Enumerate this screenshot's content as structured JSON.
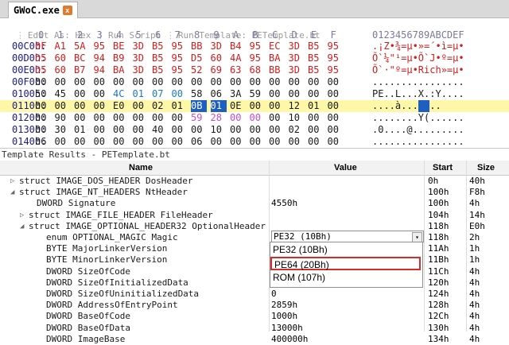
{
  "tab": {
    "title": "GWoC.exe",
    "close_glyph": "x",
    "accent": "#e07a2a"
  },
  "info_bar": {
    "edit_as": "Edit As: Hex",
    "run_script": "Run Script",
    "run_template": "Run Template: PETemplate.bt"
  },
  "hex": {
    "col_headers": [
      "0",
      "1",
      "2",
      "3",
      "4",
      "5",
      "6",
      "7",
      "8",
      "9",
      "A",
      "B",
      "C",
      "D",
      "E",
      "F"
    ],
    "ascii_header": "0123456789ABCDEF",
    "rows": [
      {
        "addr": "00C0h:",
        "bytes": [
          "0F",
          "A1",
          "5A",
          "95",
          "BE",
          "3D",
          "B5",
          "95",
          "BB",
          "3D",
          "B4",
          "95",
          "EC",
          "3D",
          "B5",
          "95"
        ],
        "ascii": ".¡Z•¾=µ•»=´•ì=µ•"
      },
      {
        "addr": "00D0h:",
        "bytes": [
          "D5",
          "60",
          "BC",
          "94",
          "B9",
          "3D",
          "B5",
          "95",
          "D5",
          "60",
          "4A",
          "95",
          "BA",
          "3D",
          "B5",
          "95"
        ],
        "ascii": "Õ`¼\"¹=µ•Õ`J•º=µ•"
      },
      {
        "addr": "00E0h:",
        "bytes": [
          "D5",
          "60",
          "B7",
          "94",
          "BA",
          "3D",
          "B5",
          "95",
          "52",
          "69",
          "63",
          "68",
          "BB",
          "3D",
          "B5",
          "95"
        ],
        "ascii": "Õ`·\"º=µ•Rich»=µ•"
      },
      {
        "addr": "00F0h:",
        "bytes": [
          "00",
          "00",
          "00",
          "00",
          "00",
          "00",
          "00",
          "00",
          "00",
          "00",
          "00",
          "00",
          "00",
          "00",
          "00",
          "00"
        ],
        "ascii": "................"
      },
      {
        "addr": "0100h:",
        "bytes": [
          "50",
          "45",
          "00",
          "00",
          "4C",
          "01",
          "07",
          "00",
          "58",
          "06",
          "3A",
          "59",
          "00",
          "00",
          "00",
          "00"
        ],
        "ascii": "PE..L...X.:Y...."
      },
      {
        "addr": "0110h:",
        "bytes": [
          "00",
          "00",
          "00",
          "00",
          "E0",
          "00",
          "02",
          "01",
          "0B",
          "01",
          "0E",
          "00",
          "00",
          "12",
          "01",
          "00"
        ],
        "ascii": "....à......."
      },
      {
        "addr": "0120h:",
        "bytes": [
          "00",
          "90",
          "00",
          "00",
          "00",
          "00",
          "00",
          "00",
          "59",
          "28",
          "00",
          "00",
          "00",
          "10",
          "00",
          "00"
        ],
        "ascii": "........Y(......"
      },
      {
        "addr": "0130h:",
        "bytes": [
          "00",
          "30",
          "01",
          "00",
          "00",
          "00",
          "40",
          "00",
          "00",
          "10",
          "00",
          "00",
          "00",
          "02",
          "00",
          "00"
        ],
        "ascii": ".0....@........."
      },
      {
        "addr": "0140h:",
        "bytes": [
          "06",
          "00",
          "00",
          "00",
          "00",
          "00",
          "00",
          "00",
          "06",
          "00",
          "00",
          "00",
          "00",
          "00",
          "00",
          "00"
        ],
        "ascii": "................"
      }
    ]
  },
  "template_results": {
    "title": "Template Results - PETemplate.bt",
    "columns": {
      "name": "Name",
      "value": "Value",
      "start": "Start",
      "size": "Size"
    },
    "rows": [
      {
        "name": "struct IMAGE_DOS_HEADER DosHeader",
        "value": "",
        "start": "0h",
        "size": "40h",
        "twisty": "▷"
      },
      {
        "name": "struct IMAGE_NT_HEADERS NtHeader",
        "value": "",
        "start": "100h",
        "size": "F8h",
        "twisty": "◢"
      },
      {
        "name": "DWORD Signature",
        "value": "4550h",
        "start": "100h",
        "size": "4h",
        "twisty": ""
      },
      {
        "name": "struct IMAGE_FILE_HEADER FileHeader",
        "value": "",
        "start": "104h",
        "size": "14h",
        "twisty": "▷"
      },
      {
        "name": "struct IMAGE_OPTIONAL_HEADER32 OptionalHeader",
        "value": "",
        "start": "118h",
        "size": "E0h",
        "twisty": "◢"
      },
      {
        "name": "enum OPTIONAL_MAGIC Magic",
        "value": "PE32 (10Bh)",
        "start": "118h",
        "size": "2h",
        "twisty": ""
      },
      {
        "name": "BYTE MajorLinkerVersion",
        "value": "",
        "start": "11Ah",
        "size": "1h",
        "twisty": ""
      },
      {
        "name": "BYTE MinorLinkerVersion",
        "value": "",
        "start": "11Bh",
        "size": "1h",
        "twisty": ""
      },
      {
        "name": "DWORD SizeOfCode",
        "value": "",
        "start": "11Ch",
        "size": "4h",
        "twisty": ""
      },
      {
        "name": "DWORD SizeOfInitializedData",
        "value": "",
        "start": "120h",
        "size": "4h",
        "twisty": ""
      },
      {
        "name": "DWORD SizeOfUninitializedData",
        "value": "0",
        "start": "124h",
        "size": "4h",
        "twisty": ""
      },
      {
        "name": "DWORD AddressOfEntryPoint",
        "value": "2859h",
        "start": "128h",
        "size": "4h",
        "twisty": ""
      },
      {
        "name": "DWORD BaseOfCode",
        "value": "1000h",
        "start": "12Ch",
        "size": "4h",
        "twisty": ""
      },
      {
        "name": "DWORD BaseOfData",
        "value": "13000h",
        "start": "130h",
        "size": "4h",
        "twisty": ""
      },
      {
        "name": "DWORD ImageBase",
        "value": "400000h",
        "start": "134h",
        "size": "4h",
        "twisty": ""
      }
    ]
  },
  "magic_dropdown": {
    "current": "PE32 (10Bh)",
    "arrow_glyph": "▾",
    "options": [
      "PE32 (10Bh)",
      "PE64 (20Bh)",
      "ROM (107h)"
    ],
    "highlight_color": "#d62b2b"
  }
}
